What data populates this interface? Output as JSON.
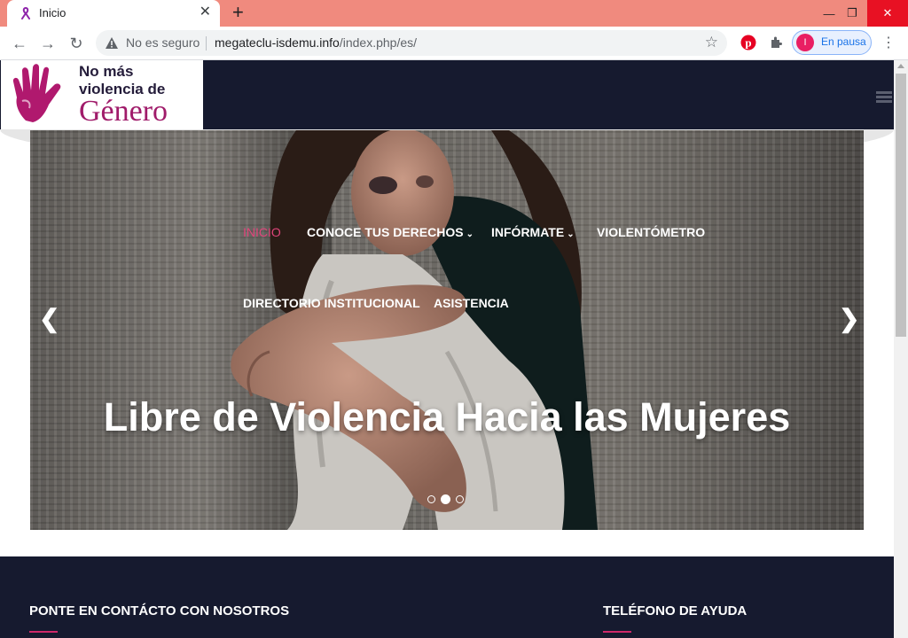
{
  "browser": {
    "tab_title": "Inicio",
    "tab_close": "✕",
    "new_tab": "+",
    "security_label": "No es seguro",
    "url_host": "megateclu-isdemu.info",
    "url_path": "/index.php/es/",
    "profile_initial": "I",
    "profile_status": "En pausa"
  },
  "site": {
    "logo_line1": "No más",
    "logo_line2": "violencia de",
    "logo_line3": "Género",
    "nav": [
      {
        "label": "INICIO"
      },
      {
        "label": "CONOCE TUS DERECHOS"
      },
      {
        "label": "INFÓRMATE"
      },
      {
        "label": "VIOLENTÓMETRO"
      },
      {
        "label": "DIRECTORIO INSTITUCIONAL"
      },
      {
        "label": "ASISTENCIA"
      }
    ],
    "slide_title": "Libre de Violencia Hacia las Mujeres",
    "slider_dots": {
      "count": 3,
      "active_index": 1
    },
    "footer_contact_title": "PONTE EN CONTÁCTO CON NOSOTROS",
    "footer_phone_title": "TELÉFONO DE AYUDA"
  },
  "colors": {
    "titlebar": "#f08a7e",
    "header_bg": "#161a2f",
    "nav_active": "#e0457b",
    "accent_line": "#d0286a",
    "logo_pink": "#a01b6a"
  }
}
